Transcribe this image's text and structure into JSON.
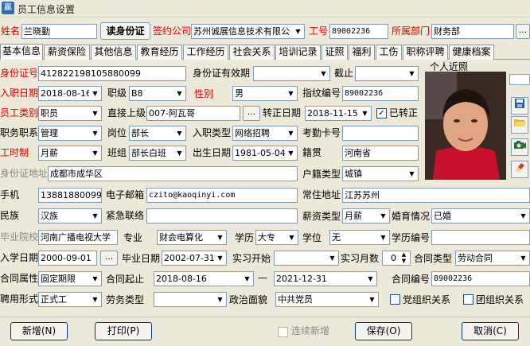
{
  "window": {
    "title": "员工信息设置",
    "icon_text": "贏"
  },
  "header": {
    "name_label": "姓名",
    "name_value": "兰晓勤",
    "read_id_button": "读身份证",
    "company_label": "签约公司",
    "company_value": "苏州诚展信息技术有限公",
    "emp_no_label": "工号",
    "emp_no_value": "89002236",
    "dept_label": "所属部门",
    "dept_value": "财务部",
    "more_button": "..."
  },
  "tabs": [
    "基本信息",
    "薪资保险",
    "其他信息",
    "教育经历",
    "工作经历",
    "社会关系",
    "培训记录",
    "证照",
    "福利",
    "工伤",
    "职称评聘",
    "健康档案"
  ],
  "form": {
    "id_no_label": "身份证号",
    "id_no_value": "412822198105880099",
    "id_valid_label": "身份证有效期",
    "id_valid_value": "",
    "deadline_label": "截止",
    "deadline_value": "",
    "photo_label": "个人近照",
    "hire_date_label": "入职日期",
    "hire_date_value": "2018-08-16",
    "rank_label": "职级",
    "rank_value": "B8",
    "gender_label": "性别",
    "gender_value": "男",
    "fingerprint_label": "指纹编号",
    "fingerprint_value": "89002236",
    "emp_type_label": "员工类别",
    "emp_type_value": "职员",
    "supervisor_label": "直接上级",
    "supervisor_value": "007-阿瓦哥",
    "regular_date_label": "转正日期",
    "regular_date_value": "2018-11-15",
    "regular_check_label": "已转正",
    "regular_checked": "✓",
    "title_label": "职务职系",
    "title_value": "管理",
    "post_label": "岗位",
    "post_value": "部长",
    "hire_type_label": "入职类型",
    "hire_type_value": "网络招聘",
    "attendance_label": "考勤卡号",
    "attendance_value": "",
    "work_hours_label": "工时制",
    "work_hours_value": "月薪",
    "shift_label": "班组",
    "shift_value": "部长白班",
    "birth_label": "出生日期",
    "birth_value": "1981-05-04",
    "native_label": "籍贯",
    "native_value": "河南省",
    "id_addr_label": "身份证地址",
    "id_addr_value": "成都市成华区",
    "hukou_type_label": "户籍类型",
    "hukou_type_value": "城镇",
    "mobile_label": "手机",
    "mobile_value": "13881880099",
    "email_label": "电子邮箱",
    "email_value": "czito@kaoqinyi.com",
    "residence_label": "常住地址",
    "residence_value": "江苏苏州",
    "ethnic_label": "民族",
    "ethnic_value": "汉族",
    "emergency_label": "紧急联络",
    "emergency_value": "",
    "salary_type_label": "薪资类型",
    "salary_type_value": "月薪",
    "marital_label": "婚育情况",
    "marital_value": "已婚",
    "school_label": "毕业院校",
    "school_value": "河南广播电视大学",
    "major_label": "专业",
    "major_value": "财会电算化",
    "education_label": "学历",
    "education_value": "大专",
    "degree_label": "学位",
    "degree_value": "无",
    "edu_no_label": "学历编号",
    "edu_no_value": "",
    "school_start_label": "入学日期",
    "school_start_value": "2000-09-01",
    "grad_date_label": "毕业日期",
    "grad_date_value": "2002-07-31",
    "intern_start_label": "实习开始",
    "intern_start_value": "",
    "intern_months_label": "实习月数",
    "intern_months_value": "0",
    "contract_type_label": "合同类型",
    "contract_type_value": "劳动合同",
    "contract_attr_label": "合同属性",
    "contract_attr_value": "固定期限",
    "contract_start_label": "合同起止",
    "contract_start_value": "2018-08-16",
    "contract_dash": "—",
    "contract_end_value": "2021-12-31",
    "contract_no_label": "合同编号",
    "contract_no_value": "89002236",
    "employ_form_label": "聘用形式",
    "employ_form_value": "正式工",
    "labor_type_label": "劳务类型",
    "labor_type_value": "",
    "political_label": "政治面貌",
    "political_value": "中共党员",
    "party_org_label": "党组织关系",
    "union_org_label": "团组织关系"
  },
  "footer": {
    "new_button": "新增(N)",
    "print_button": "打印(P)",
    "continue_label": "连续新增",
    "save_button": "保存(O)",
    "cancel_button": "取消(C)"
  },
  "sidebar": {
    "save_icon": "save-icon",
    "open_icon": "folder-open-icon",
    "camera_icon": "camera-icon",
    "eraser_icon": "eraser-icon"
  },
  "colors": {
    "required_label": "#e00000",
    "photo_bg": "#3d2c25",
    "shirt": "#c8102e"
  }
}
